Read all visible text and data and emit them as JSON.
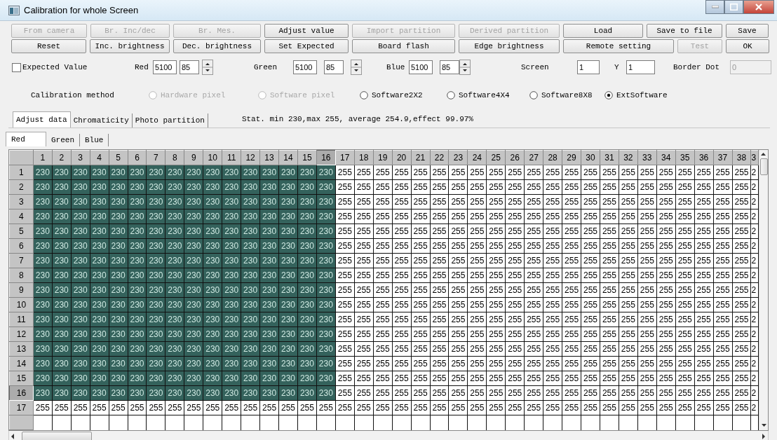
{
  "window": {
    "title": "Calibration for whole Screen"
  },
  "button_rows": [
    {
      "buttons": [
        {
          "label": "From camera",
          "disabled": true
        },
        {
          "label": "Br. Inc/dec",
          "disabled": true
        },
        {
          "label": "Br. Mes.",
          "disabled": true
        },
        {
          "label": "Adjust value",
          "disabled": false
        },
        {
          "label": "Import partition",
          "disabled": true
        },
        {
          "label": "Derived partition",
          "disabled": true
        },
        {
          "label": "Load",
          "disabled": false
        },
        {
          "label": "Save to file",
          "disabled": false
        },
        {
          "label": "Save",
          "disabled": false
        }
      ]
    },
    {
      "buttons": [
        {
          "label": "Reset",
          "disabled": false
        },
        {
          "label": "Inc. brightness",
          "disabled": false
        },
        {
          "label": "Dec. brightness",
          "disabled": false
        },
        {
          "label": "Set Expected",
          "disabled": false
        },
        {
          "label": "Board flash",
          "disabled": false
        },
        {
          "label": "Edge brightness",
          "disabled": false
        },
        {
          "label": "Remote setting",
          "disabled": false
        },
        {
          "label": "Test",
          "disabled": true
        },
        {
          "label": "OK",
          "disabled": false
        }
      ]
    }
  ],
  "expected_value": {
    "label": "Expected Value",
    "checked": false
  },
  "channels": [
    {
      "label": "Red",
      "value": "5100",
      "step": "85"
    },
    {
      "label": "Green",
      "value": "5100",
      "step": "85"
    },
    {
      "label": "Blue",
      "value": "5100",
      "step": "85"
    }
  ],
  "screen": {
    "label": "Screen",
    "value": "1"
  },
  "y": {
    "label": "Y",
    "value": "1"
  },
  "border_dot": {
    "label": "Border Dot",
    "value": "0",
    "disabled": true
  },
  "calibration_method": {
    "label": "Calibration method",
    "options": [
      {
        "label": "Hardware pixel",
        "disabled": true,
        "selected": false
      },
      {
        "label": "Software pixel",
        "disabled": true,
        "selected": false
      },
      {
        "label": "Software2X2",
        "disabled": false,
        "selected": false
      },
      {
        "label": "Software4X4",
        "disabled": false,
        "selected": false
      },
      {
        "label": "Software8X8",
        "disabled": false,
        "selected": false
      },
      {
        "label": "ExtSoftware",
        "disabled": false,
        "selected": true
      }
    ]
  },
  "tabs": [
    {
      "label": "Adjust data",
      "selected": true
    },
    {
      "label": "Chromaticity",
      "selected": false
    },
    {
      "label": "Photo partition",
      "selected": false
    }
  ],
  "stat": "Stat. min 230,max 255, average 254.9,effect 99.97%",
  "color_tabs": [
    {
      "label": "Red",
      "selected": true
    },
    {
      "label": "Green",
      "selected": false
    },
    {
      "label": "Blue",
      "selected": false
    }
  ],
  "grid": {
    "columns": [
      {
        "label": "1",
        "current": false
      },
      {
        "label": "2",
        "current": false
      },
      {
        "label": "3",
        "current": false
      },
      {
        "label": "4",
        "current": false
      },
      {
        "label": "5",
        "current": false
      },
      {
        "label": "6",
        "current": false
      },
      {
        "label": "7",
        "current": false
      },
      {
        "label": "8",
        "current": false
      },
      {
        "label": "9",
        "current": false
      },
      {
        "label": "10",
        "current": false
      },
      {
        "label": "11",
        "current": false
      },
      {
        "label": "12",
        "current": false
      },
      {
        "label": "13",
        "current": false
      },
      {
        "label": "14",
        "current": false
      },
      {
        "label": "15",
        "current": false
      },
      {
        "label": "16",
        "current": true
      },
      {
        "label": "17",
        "current": false
      },
      {
        "label": "18",
        "current": false
      },
      {
        "label": "19",
        "current": false
      },
      {
        "label": "20",
        "current": false
      },
      {
        "label": "21",
        "current": false
      },
      {
        "label": "22",
        "current": false
      },
      {
        "label": "23",
        "current": false
      },
      {
        "label": "24",
        "current": false
      },
      {
        "label": "25",
        "current": false
      },
      {
        "label": "26",
        "current": false
      },
      {
        "label": "27",
        "current": false
      },
      {
        "label": "28",
        "current": false
      },
      {
        "label": "29",
        "current": false
      },
      {
        "label": "30",
        "current": false
      },
      {
        "label": "31",
        "current": false
      },
      {
        "label": "32",
        "current": false
      },
      {
        "label": "33",
        "current": false
      },
      {
        "label": "34",
        "current": false
      },
      {
        "label": "35",
        "current": false
      },
      {
        "label": "36",
        "current": false
      },
      {
        "label": "37",
        "current": false
      },
      {
        "label": "38",
        "current": false
      },
      {
        "label": "3",
        "current": false
      }
    ],
    "rows": [
      {
        "header": "1",
        "current": false,
        "cells": [
          "230",
          "230",
          "230",
          "230",
          "230",
          "230",
          "230",
          "230",
          "230",
          "230",
          "230",
          "230",
          "230",
          "230",
          "230",
          "230",
          "255",
          "255",
          "255",
          "255",
          "255",
          "255",
          "255",
          "255",
          "255",
          "255",
          "255",
          "255",
          "255",
          "255",
          "255",
          "255",
          "255",
          "255",
          "255",
          "255",
          "255",
          "255",
          "2"
        ],
        "selected": [
          true,
          true,
          true,
          true,
          true,
          true,
          true,
          true,
          true,
          true,
          true,
          true,
          true,
          true,
          true,
          true,
          false,
          false,
          false,
          false,
          false,
          false,
          false,
          false,
          false,
          false,
          false,
          false,
          false,
          false,
          false,
          false,
          false,
          false,
          false,
          false,
          false,
          false,
          false
        ]
      },
      {
        "header": "2",
        "current": false,
        "cells": [
          "230",
          "230",
          "230",
          "230",
          "230",
          "230",
          "230",
          "230",
          "230",
          "230",
          "230",
          "230",
          "230",
          "230",
          "230",
          "230",
          "255",
          "255",
          "255",
          "255",
          "255",
          "255",
          "255",
          "255",
          "255",
          "255",
          "255",
          "255",
          "255",
          "255",
          "255",
          "255",
          "255",
          "255",
          "255",
          "255",
          "255",
          "255",
          "2"
        ],
        "selected": [
          true,
          true,
          true,
          true,
          true,
          true,
          true,
          true,
          true,
          true,
          true,
          true,
          true,
          true,
          true,
          true,
          false,
          false,
          false,
          false,
          false,
          false,
          false,
          false,
          false,
          false,
          false,
          false,
          false,
          false,
          false,
          false,
          false,
          false,
          false,
          false,
          false,
          false,
          false
        ]
      },
      {
        "header": "3",
        "current": false,
        "cells": [
          "230",
          "230",
          "230",
          "230",
          "230",
          "230",
          "230",
          "230",
          "230",
          "230",
          "230",
          "230",
          "230",
          "230",
          "230",
          "230",
          "255",
          "255",
          "255",
          "255",
          "255",
          "255",
          "255",
          "255",
          "255",
          "255",
          "255",
          "255",
          "255",
          "255",
          "255",
          "255",
          "255",
          "255",
          "255",
          "255",
          "255",
          "255",
          "2"
        ],
        "selected": [
          true,
          true,
          true,
          true,
          true,
          true,
          true,
          true,
          true,
          true,
          true,
          true,
          true,
          true,
          true,
          true,
          false,
          false,
          false,
          false,
          false,
          false,
          false,
          false,
          false,
          false,
          false,
          false,
          false,
          false,
          false,
          false,
          false,
          false,
          false,
          false,
          false,
          false,
          false
        ]
      },
      {
        "header": "4",
        "current": false,
        "cells": [
          "230",
          "230",
          "230",
          "230",
          "230",
          "230",
          "230",
          "230",
          "230",
          "230",
          "230",
          "230",
          "230",
          "230",
          "230",
          "230",
          "255",
          "255",
          "255",
          "255",
          "255",
          "255",
          "255",
          "255",
          "255",
          "255",
          "255",
          "255",
          "255",
          "255",
          "255",
          "255",
          "255",
          "255",
          "255",
          "255",
          "255",
          "255",
          "2"
        ],
        "selected": [
          true,
          true,
          true,
          true,
          true,
          true,
          true,
          true,
          true,
          true,
          true,
          true,
          true,
          true,
          true,
          true,
          false,
          false,
          false,
          false,
          false,
          false,
          false,
          false,
          false,
          false,
          false,
          false,
          false,
          false,
          false,
          false,
          false,
          false,
          false,
          false,
          false,
          false,
          false
        ]
      },
      {
        "header": "5",
        "current": false,
        "cells": [
          "230",
          "230",
          "230",
          "230",
          "230",
          "230",
          "230",
          "230",
          "230",
          "230",
          "230",
          "230",
          "230",
          "230",
          "230",
          "230",
          "255",
          "255",
          "255",
          "255",
          "255",
          "255",
          "255",
          "255",
          "255",
          "255",
          "255",
          "255",
          "255",
          "255",
          "255",
          "255",
          "255",
          "255",
          "255",
          "255",
          "255",
          "255",
          "2"
        ],
        "selected": [
          true,
          true,
          true,
          true,
          true,
          true,
          true,
          true,
          true,
          true,
          true,
          true,
          true,
          true,
          true,
          true,
          false,
          false,
          false,
          false,
          false,
          false,
          false,
          false,
          false,
          false,
          false,
          false,
          false,
          false,
          false,
          false,
          false,
          false,
          false,
          false,
          false,
          false,
          false
        ]
      },
      {
        "header": "6",
        "current": false,
        "cells": [
          "230",
          "230",
          "230",
          "230",
          "230",
          "230",
          "230",
          "230",
          "230",
          "230",
          "230",
          "230",
          "230",
          "230",
          "230",
          "230",
          "255",
          "255",
          "255",
          "255",
          "255",
          "255",
          "255",
          "255",
          "255",
          "255",
          "255",
          "255",
          "255",
          "255",
          "255",
          "255",
          "255",
          "255",
          "255",
          "255",
          "255",
          "255",
          "2"
        ],
        "selected": [
          true,
          true,
          true,
          true,
          true,
          true,
          true,
          true,
          true,
          true,
          true,
          true,
          true,
          true,
          true,
          true,
          false,
          false,
          false,
          false,
          false,
          false,
          false,
          false,
          false,
          false,
          false,
          false,
          false,
          false,
          false,
          false,
          false,
          false,
          false,
          false,
          false,
          false,
          false
        ]
      },
      {
        "header": "7",
        "current": false,
        "cells": [
          "230",
          "230",
          "230",
          "230",
          "230",
          "230",
          "230",
          "230",
          "230",
          "230",
          "230",
          "230",
          "230",
          "230",
          "230",
          "230",
          "255",
          "255",
          "255",
          "255",
          "255",
          "255",
          "255",
          "255",
          "255",
          "255",
          "255",
          "255",
          "255",
          "255",
          "255",
          "255",
          "255",
          "255",
          "255",
          "255",
          "255",
          "255",
          "2"
        ],
        "selected": [
          true,
          true,
          true,
          true,
          true,
          true,
          true,
          true,
          true,
          true,
          true,
          true,
          true,
          true,
          true,
          true,
          false,
          false,
          false,
          false,
          false,
          false,
          false,
          false,
          false,
          false,
          false,
          false,
          false,
          false,
          false,
          false,
          false,
          false,
          false,
          false,
          false,
          false,
          false
        ]
      },
      {
        "header": "8",
        "current": false,
        "cells": [
          "230",
          "230",
          "230",
          "230",
          "230",
          "230",
          "230",
          "230",
          "230",
          "230",
          "230",
          "230",
          "230",
          "230",
          "230",
          "230",
          "255",
          "255",
          "255",
          "255",
          "255",
          "255",
          "255",
          "255",
          "255",
          "255",
          "255",
          "255",
          "255",
          "255",
          "255",
          "255",
          "255",
          "255",
          "255",
          "255",
          "255",
          "255",
          "2"
        ],
        "selected": [
          true,
          true,
          true,
          true,
          true,
          true,
          true,
          true,
          true,
          true,
          true,
          true,
          true,
          true,
          true,
          true,
          false,
          false,
          false,
          false,
          false,
          false,
          false,
          false,
          false,
          false,
          false,
          false,
          false,
          false,
          false,
          false,
          false,
          false,
          false,
          false,
          false,
          false,
          false
        ]
      },
      {
        "header": "9",
        "current": false,
        "cells": [
          "230",
          "230",
          "230",
          "230",
          "230",
          "230",
          "230",
          "230",
          "230",
          "230",
          "230",
          "230",
          "230",
          "230",
          "230",
          "230",
          "255",
          "255",
          "255",
          "255",
          "255",
          "255",
          "255",
          "255",
          "255",
          "255",
          "255",
          "255",
          "255",
          "255",
          "255",
          "255",
          "255",
          "255",
          "255",
          "255",
          "255",
          "255",
          "2"
        ],
        "selected": [
          true,
          true,
          true,
          true,
          true,
          true,
          true,
          true,
          true,
          true,
          true,
          true,
          true,
          true,
          true,
          true,
          false,
          false,
          false,
          false,
          false,
          false,
          false,
          false,
          false,
          false,
          false,
          false,
          false,
          false,
          false,
          false,
          false,
          false,
          false,
          false,
          false,
          false,
          false
        ]
      },
      {
        "header": "10",
        "current": false,
        "cells": [
          "230",
          "230",
          "230",
          "230",
          "230",
          "230",
          "230",
          "230",
          "230",
          "230",
          "230",
          "230",
          "230",
          "230",
          "230",
          "230",
          "255",
          "255",
          "255",
          "255",
          "255",
          "255",
          "255",
          "255",
          "255",
          "255",
          "255",
          "255",
          "255",
          "255",
          "255",
          "255",
          "255",
          "255",
          "255",
          "255",
          "255",
          "255",
          "2"
        ],
        "selected": [
          true,
          true,
          true,
          true,
          true,
          true,
          true,
          true,
          true,
          true,
          true,
          true,
          true,
          true,
          true,
          true,
          false,
          false,
          false,
          false,
          false,
          false,
          false,
          false,
          false,
          false,
          false,
          false,
          false,
          false,
          false,
          false,
          false,
          false,
          false,
          false,
          false,
          false,
          false
        ]
      },
      {
        "header": "11",
        "current": false,
        "cells": [
          "230",
          "230",
          "230",
          "230",
          "230",
          "230",
          "230",
          "230",
          "230",
          "230",
          "230",
          "230",
          "230",
          "230",
          "230",
          "230",
          "255",
          "255",
          "255",
          "255",
          "255",
          "255",
          "255",
          "255",
          "255",
          "255",
          "255",
          "255",
          "255",
          "255",
          "255",
          "255",
          "255",
          "255",
          "255",
          "255",
          "255",
          "255",
          "2"
        ],
        "selected": [
          true,
          true,
          true,
          true,
          true,
          true,
          true,
          true,
          true,
          true,
          true,
          true,
          true,
          true,
          true,
          true,
          false,
          false,
          false,
          false,
          false,
          false,
          false,
          false,
          false,
          false,
          false,
          false,
          false,
          false,
          false,
          false,
          false,
          false,
          false,
          false,
          false,
          false,
          false
        ]
      },
      {
        "header": "12",
        "current": false,
        "cells": [
          "230",
          "230",
          "230",
          "230",
          "230",
          "230",
          "230",
          "230",
          "230",
          "230",
          "230",
          "230",
          "230",
          "230",
          "230",
          "230",
          "255",
          "255",
          "255",
          "255",
          "255",
          "255",
          "255",
          "255",
          "255",
          "255",
          "255",
          "255",
          "255",
          "255",
          "255",
          "255",
          "255",
          "255",
          "255",
          "255",
          "255",
          "255",
          "2"
        ],
        "selected": [
          true,
          true,
          true,
          true,
          true,
          true,
          true,
          true,
          true,
          true,
          true,
          true,
          true,
          true,
          true,
          true,
          false,
          false,
          false,
          false,
          false,
          false,
          false,
          false,
          false,
          false,
          false,
          false,
          false,
          false,
          false,
          false,
          false,
          false,
          false,
          false,
          false,
          false,
          false
        ]
      },
      {
        "header": "13",
        "current": false,
        "cells": [
          "230",
          "230",
          "230",
          "230",
          "230",
          "230",
          "230",
          "230",
          "230",
          "230",
          "230",
          "230",
          "230",
          "230",
          "230",
          "230",
          "255",
          "255",
          "255",
          "255",
          "255",
          "255",
          "255",
          "255",
          "255",
          "255",
          "255",
          "255",
          "255",
          "255",
          "255",
          "255",
          "255",
          "255",
          "255",
          "255",
          "255",
          "255",
          "2"
        ],
        "selected": [
          true,
          true,
          true,
          true,
          true,
          true,
          true,
          true,
          true,
          true,
          true,
          true,
          true,
          true,
          true,
          true,
          false,
          false,
          false,
          false,
          false,
          false,
          false,
          false,
          false,
          false,
          false,
          false,
          false,
          false,
          false,
          false,
          false,
          false,
          false,
          false,
          false,
          false,
          false
        ]
      },
      {
        "header": "14",
        "current": false,
        "cells": [
          "230",
          "230",
          "230",
          "230",
          "230",
          "230",
          "230",
          "230",
          "230",
          "230",
          "230",
          "230",
          "230",
          "230",
          "230",
          "230",
          "255",
          "255",
          "255",
          "255",
          "255",
          "255",
          "255",
          "255",
          "255",
          "255",
          "255",
          "255",
          "255",
          "255",
          "255",
          "255",
          "255",
          "255",
          "255",
          "255",
          "255",
          "255",
          "2"
        ],
        "selected": [
          true,
          true,
          true,
          true,
          true,
          true,
          true,
          true,
          true,
          true,
          true,
          true,
          true,
          true,
          true,
          true,
          false,
          false,
          false,
          false,
          false,
          false,
          false,
          false,
          false,
          false,
          false,
          false,
          false,
          false,
          false,
          false,
          false,
          false,
          false,
          false,
          false,
          false,
          false
        ]
      },
      {
        "header": "15",
        "current": false,
        "cells": [
          "230",
          "230",
          "230",
          "230",
          "230",
          "230",
          "230",
          "230",
          "230",
          "230",
          "230",
          "230",
          "230",
          "230",
          "230",
          "230",
          "255",
          "255",
          "255",
          "255",
          "255",
          "255",
          "255",
          "255",
          "255",
          "255",
          "255",
          "255",
          "255",
          "255",
          "255",
          "255",
          "255",
          "255",
          "255",
          "255",
          "255",
          "255",
          "2"
        ],
        "selected": [
          true,
          true,
          true,
          true,
          true,
          true,
          true,
          true,
          true,
          true,
          true,
          true,
          true,
          true,
          true,
          true,
          false,
          false,
          false,
          false,
          false,
          false,
          false,
          false,
          false,
          false,
          false,
          false,
          false,
          false,
          false,
          false,
          false,
          false,
          false,
          false,
          false,
          false,
          false
        ]
      },
      {
        "header": "16",
        "current": true,
        "cells": [
          "230",
          "230",
          "230",
          "230",
          "230",
          "230",
          "230",
          "230",
          "230",
          "230",
          "230",
          "230",
          "230",
          "230",
          "230",
          "230",
          "255",
          "255",
          "255",
          "255",
          "255",
          "255",
          "255",
          "255",
          "255",
          "255",
          "255",
          "255",
          "255",
          "255",
          "255",
          "255",
          "255",
          "255",
          "255",
          "255",
          "255",
          "255",
          "2"
        ],
        "selected": [
          true,
          true,
          true,
          true,
          true,
          true,
          true,
          true,
          true,
          true,
          true,
          true,
          true,
          true,
          true,
          true,
          false,
          false,
          false,
          false,
          false,
          false,
          false,
          false,
          false,
          false,
          false,
          false,
          false,
          false,
          false,
          false,
          false,
          false,
          false,
          false,
          false,
          false,
          false
        ]
      },
      {
        "header": "17",
        "current": false,
        "cells": [
          "255",
          "255",
          "255",
          "255",
          "255",
          "255",
          "255",
          "255",
          "255",
          "255",
          "255",
          "255",
          "255",
          "255",
          "255",
          "255",
          "255",
          "255",
          "255",
          "255",
          "255",
          "255",
          "255",
          "255",
          "255",
          "255",
          "255",
          "255",
          "255",
          "255",
          "255",
          "255",
          "255",
          "255",
          "255",
          "255",
          "255",
          "255",
          "2"
        ],
        "selected": [
          false,
          false,
          false,
          false,
          false,
          false,
          false,
          false,
          false,
          false,
          false,
          false,
          false,
          false,
          false,
          false,
          false,
          false,
          false,
          false,
          false,
          false,
          false,
          false,
          false,
          false,
          false,
          false,
          false,
          false,
          false,
          false,
          false,
          false,
          false,
          false,
          false,
          false,
          false
        ]
      }
    ]
  }
}
